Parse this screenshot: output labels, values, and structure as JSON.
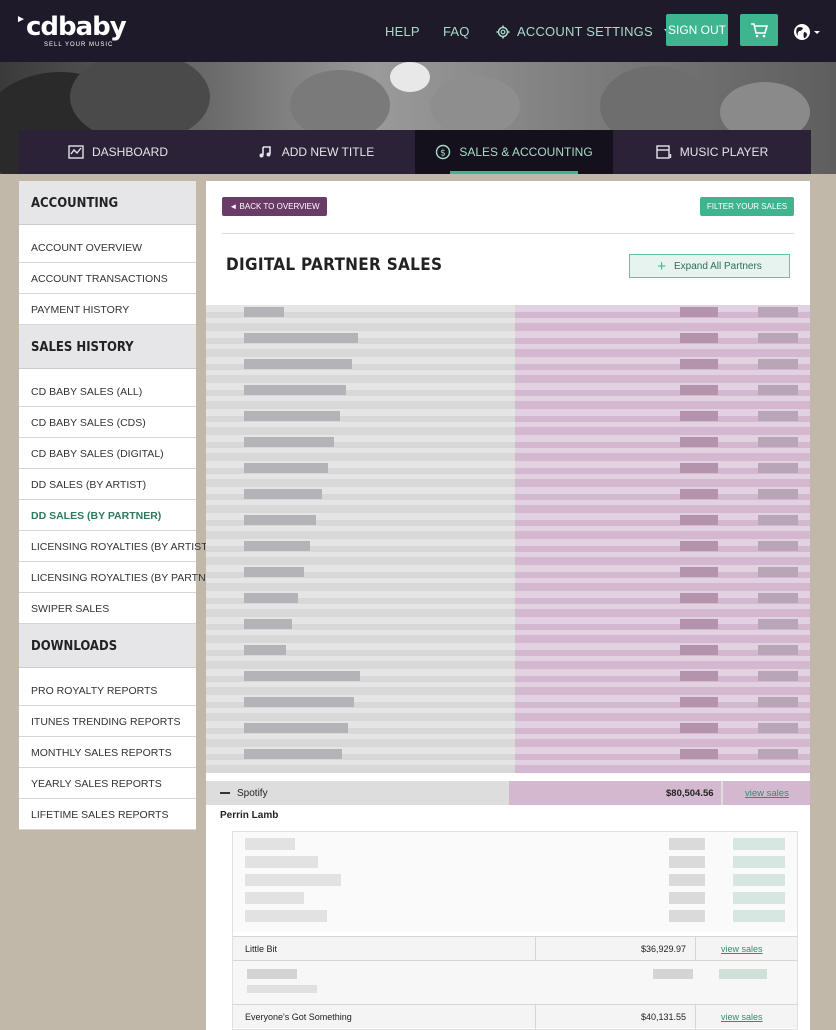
{
  "header": {
    "logo_text": "cdbaby",
    "logo_tagline": "SELL YOUR MUSIC",
    "help_label": "HELP",
    "faq_label": "FAQ",
    "account_settings_label": "ACCOUNT SETTINGS",
    "signout_label": "SIGN OUT"
  },
  "main_nav": {
    "items": [
      {
        "label": "DASHBOARD",
        "icon": "dashboard-icon"
      },
      {
        "label": "ADD NEW TITLE",
        "icon": "music-note-icon"
      },
      {
        "label": "SALES & ACCOUNTING",
        "icon": "dollar-circle-icon",
        "active": true
      },
      {
        "label": "MUSIC PLAYER",
        "icon": "player-icon"
      }
    ]
  },
  "sidebar": {
    "sections": [
      {
        "title": "ACCOUNTING",
        "items": [
          "ACCOUNT OVERVIEW",
          "ACCOUNT TRANSACTIONS",
          "PAYMENT HISTORY"
        ]
      },
      {
        "title": "SALES HISTORY",
        "items": [
          "CD BABY SALES (ALL)",
          "CD BABY SALES (CDS)",
          "CD BABY SALES (DIGITAL)",
          "DD SALES (BY ARTIST)",
          "DD SALES (BY PARTNER)",
          "LICENSING ROYALTIES (BY ARTIST)",
          "LICENSING ROYALTIES (BY PARTNER)",
          "SWIPER SALES"
        ]
      },
      {
        "title": "DOWNLOADS",
        "items": [
          "PRO ROYALTY REPORTS",
          "ITUNES TRENDING REPORTS",
          "MONTHLY SALES REPORTS",
          "YEARLY SALES REPORTS",
          "LIFETIME SALES REPORTS"
        ]
      }
    ],
    "active_item": "DD SALES (BY PARTNER)"
  },
  "content": {
    "back_label": "◄ BACK TO OVERVIEW",
    "filter_label": "FILTER YOUR SALES",
    "page_title": "DIGITAL PARTNER SALES",
    "expand_label": "Expand All Partners",
    "expand_icon": "+",
    "partner": {
      "name": "Spotify",
      "amount": "$80,504.56",
      "link": "view sales",
      "artist": "Perrin Lamb",
      "tracks": [
        {
          "title": "Little Bit",
          "amount": "$36,929.97",
          "link": "view sales"
        },
        {
          "title": "Everyone's Got Something",
          "amount": "$40,131.55",
          "link": "view sales"
        }
      ]
    }
  },
  "colors": {
    "accent_green": "#3fb58f",
    "nav_purple": "#2b2238",
    "back_purple": "#6a3b66",
    "blur_pink": "#d3b8cf"
  }
}
